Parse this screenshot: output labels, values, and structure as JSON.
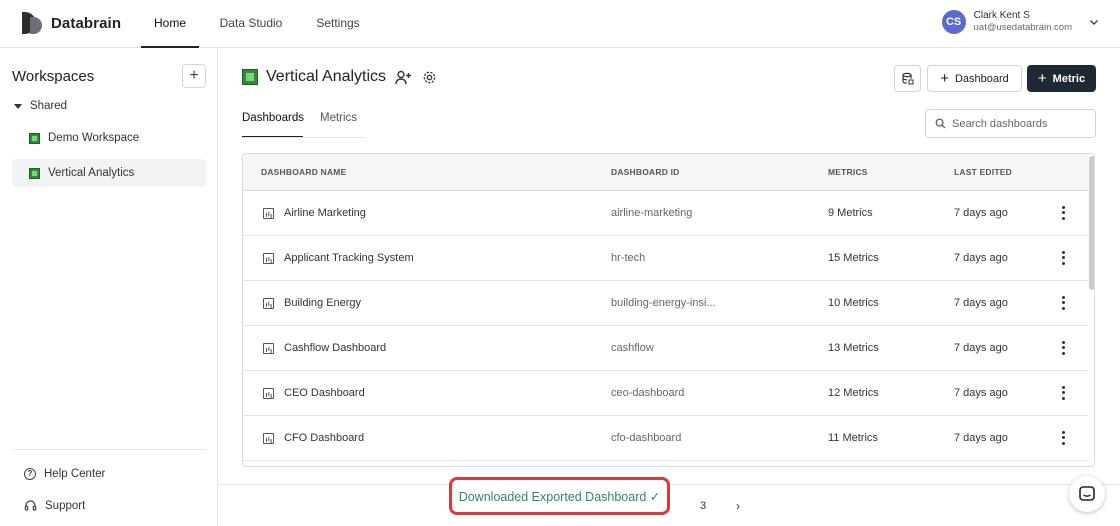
{
  "brand": {
    "name": "Databrain"
  },
  "nav": {
    "tabs": [
      {
        "label": "Home"
      },
      {
        "label": "Data Studio"
      },
      {
        "label": "Settings"
      }
    ]
  },
  "user": {
    "initials": "CS",
    "name": "Clark Kent S",
    "email": "uat@usedatabrain.com"
  },
  "sidebar": {
    "title": "Workspaces",
    "group": "Shared",
    "workspaces": [
      {
        "label": "Demo Workspace"
      },
      {
        "label": "Vertical Analytics"
      }
    ],
    "links": [
      {
        "label": "Help Center",
        "icon": "help-circle-icon"
      },
      {
        "label": "Support",
        "icon": "headset-icon"
      }
    ]
  },
  "main": {
    "title": "Vertical Analytics",
    "buttons": {
      "dashboard": "Dashboard",
      "metric": "Metric"
    },
    "tabs": [
      {
        "label": "Dashboards"
      },
      {
        "label": "Metrics"
      }
    ],
    "search": {
      "placeholder": "Search dashboards"
    }
  },
  "table": {
    "columns": [
      "DASHBOARD NAME",
      "DASHBOARD ID",
      "METRICS",
      "LAST EDITED"
    ],
    "rows": [
      {
        "name": "Airline Marketing",
        "id": "airline-marketing",
        "metrics": "9 Metrics",
        "edited": "7 days ago"
      },
      {
        "name": "Applicant Tracking System",
        "id": "hr-tech",
        "metrics": "15 Metrics",
        "edited": "7 days ago"
      },
      {
        "name": "Building Energy",
        "id": "building-energy-insi...",
        "metrics": "10 Metrics",
        "edited": "7 days ago"
      },
      {
        "name": "Cashflow Dashboard",
        "id": "cashflow",
        "metrics": "13 Metrics",
        "edited": "7 days ago"
      },
      {
        "name": "CEO Dashboard",
        "id": "ceo-dashboard",
        "metrics": "12 Metrics",
        "edited": "7 days ago"
      },
      {
        "name": "CFO Dashboard",
        "id": "cfo-dashboard",
        "metrics": "11 Metrics",
        "edited": "7 days ago"
      }
    ]
  },
  "pagination": {
    "page": "3",
    "next": "›"
  },
  "toast": {
    "message": "Downloaded Exported Dashboard ✓"
  },
  "colors": {
    "primary": "#1f2933",
    "avatar": "#5b6ad0",
    "toast_text": "#2e8b57",
    "toast_border": "#d63a3a",
    "workspace_icon": "#2f8a3a"
  }
}
